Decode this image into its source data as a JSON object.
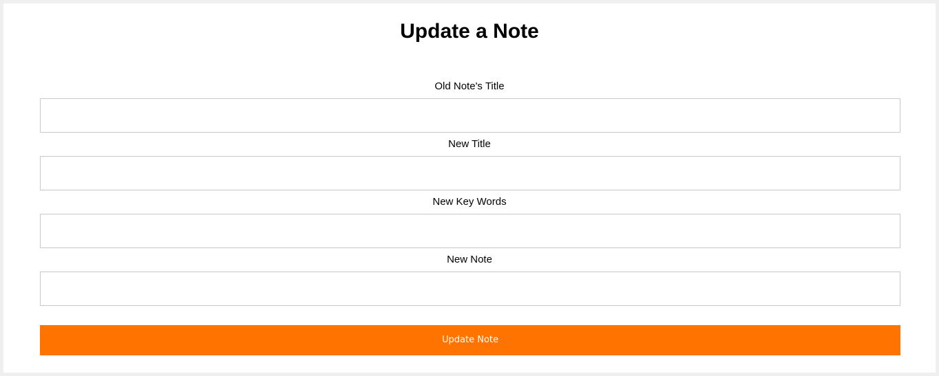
{
  "page": {
    "title": "Update a Note"
  },
  "form": {
    "fields": [
      {
        "label": "Old Note's Title",
        "value": "",
        "placeholder": ""
      },
      {
        "label": "New Title",
        "value": "",
        "placeholder": ""
      },
      {
        "label": "New Key Words",
        "value": "",
        "placeholder": ""
      },
      {
        "label": "New Note",
        "value": "",
        "placeholder": ""
      }
    ],
    "submit_label": "Update Note"
  },
  "colors": {
    "accent": "#ff7300",
    "border": "#c8c8c8",
    "frame": "#efefef"
  }
}
